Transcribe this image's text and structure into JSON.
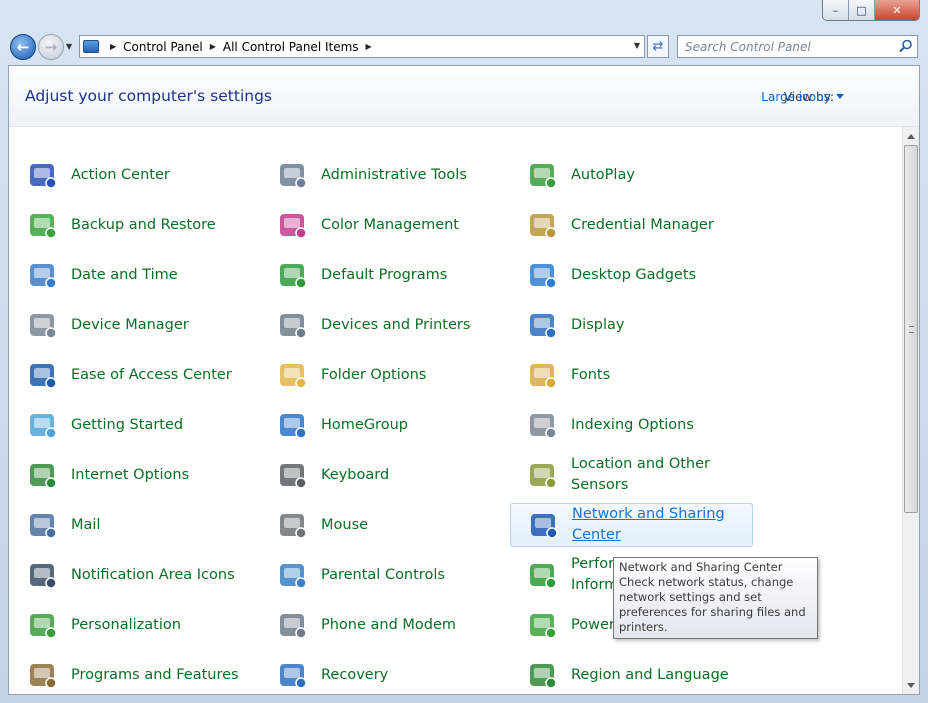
{
  "window": {
    "minimize": "–",
    "maximize": "□",
    "close": "✕"
  },
  "nav": {
    "back_glyph": "←",
    "forward_glyph": "→",
    "breadcrumbs": [
      "Control Panel",
      "All Control Panel Items"
    ],
    "search_placeholder": "Search Control Panel"
  },
  "header": {
    "title": "Adjust your computer's settings",
    "view_by_label": "View by:",
    "view_by_value": "Large icons"
  },
  "items": [
    {
      "label": "Action Center",
      "icon": "flag-icon",
      "color": "#2a4fb5"
    },
    {
      "label": "Administrative Tools",
      "icon": "admin-tools-icon",
      "color": "#6b7f96"
    },
    {
      "label": "AutoPlay",
      "icon": "autoplay-icon",
      "color": "#3b9c3b"
    },
    {
      "label": "Backup and Restore",
      "icon": "backup-icon",
      "color": "#3aa33a"
    },
    {
      "label": "Color Management",
      "icon": "color-management-icon",
      "color": "#c23b8b"
    },
    {
      "label": "Credential Manager",
      "icon": "vault-icon",
      "color": "#b8963a"
    },
    {
      "label": "Date and Time",
      "icon": "calendar-clock-icon",
      "color": "#3c7ec6"
    },
    {
      "label": "Default Programs",
      "icon": "default-programs-icon",
      "color": "#2e9a3c"
    },
    {
      "label": "Desktop Gadgets",
      "icon": "gadgets-icon",
      "color": "#2f7fd0"
    },
    {
      "label": "Device Manager",
      "icon": "device-manager-icon",
      "color": "#7a8693"
    },
    {
      "label": "Devices and Printers",
      "icon": "printer-icon",
      "color": "#6d7b8a"
    },
    {
      "label": "Display",
      "icon": "display-icon",
      "color": "#2b6fbf"
    },
    {
      "label": "Ease of Access Center",
      "icon": "ease-of-access-icon",
      "color": "#1f5aa8"
    },
    {
      "label": "Folder Options",
      "icon": "folder-options-icon",
      "color": "#e0b54a"
    },
    {
      "label": "Fonts",
      "icon": "fonts-icon",
      "color": "#d9a93c"
    },
    {
      "label": "Getting Started",
      "icon": "getting-started-icon",
      "color": "#4fa3d8"
    },
    {
      "label": "HomeGroup",
      "icon": "homegroup-icon",
      "color": "#2d73c4"
    },
    {
      "label": "Indexing Options",
      "icon": "magnifier-icon",
      "color": "#7a8693"
    },
    {
      "label": "Internet Options",
      "icon": "globe-icon",
      "color": "#2f8a3a"
    },
    {
      "label": "Keyboard",
      "icon": "keyboard-icon",
      "color": "#5a5f66"
    },
    {
      "label": "Location and Other Sensors",
      "icon": "sensor-icon",
      "color": "#8a9a3a"
    },
    {
      "label": "Mail",
      "icon": "mail-icon",
      "color": "#4a6f9c"
    },
    {
      "label": "Mouse",
      "icon": "mouse-icon",
      "color": "#6d737a"
    },
    {
      "label": "Network and Sharing Center",
      "icon": "network-icon",
      "color": "#1f58b0"
    },
    {
      "label": "Notification Area Icons",
      "icon": "notification-area-icon",
      "color": "#3a4e66"
    },
    {
      "label": "Parental Controls",
      "icon": "parental-controls-icon",
      "color": "#3b7fc4"
    },
    {
      "label": "Performance Information and Tools",
      "icon": "performance-icon",
      "color": "#2f9a3a"
    },
    {
      "label": "Personalization",
      "icon": "personalization-icon",
      "color": "#3b9c3b"
    },
    {
      "label": "Phone and Modem",
      "icon": "phone-icon",
      "color": "#6d7b8a"
    },
    {
      "label": "Power Options",
      "icon": "battery-icon",
      "color": "#3ba23b"
    },
    {
      "label": "Programs and Features",
      "icon": "programs-icon",
      "color": "#8c6b3a"
    },
    {
      "label": "Recovery",
      "icon": "recovery-icon",
      "color": "#2f6fbf"
    },
    {
      "label": "Region and Language",
      "icon": "region-globe-icon",
      "color": "#2f8a3a"
    }
  ],
  "tooltip": {
    "title": "Network and Sharing Center",
    "body": "Check network status, change network settings and set preferences for sharing files and printers."
  }
}
